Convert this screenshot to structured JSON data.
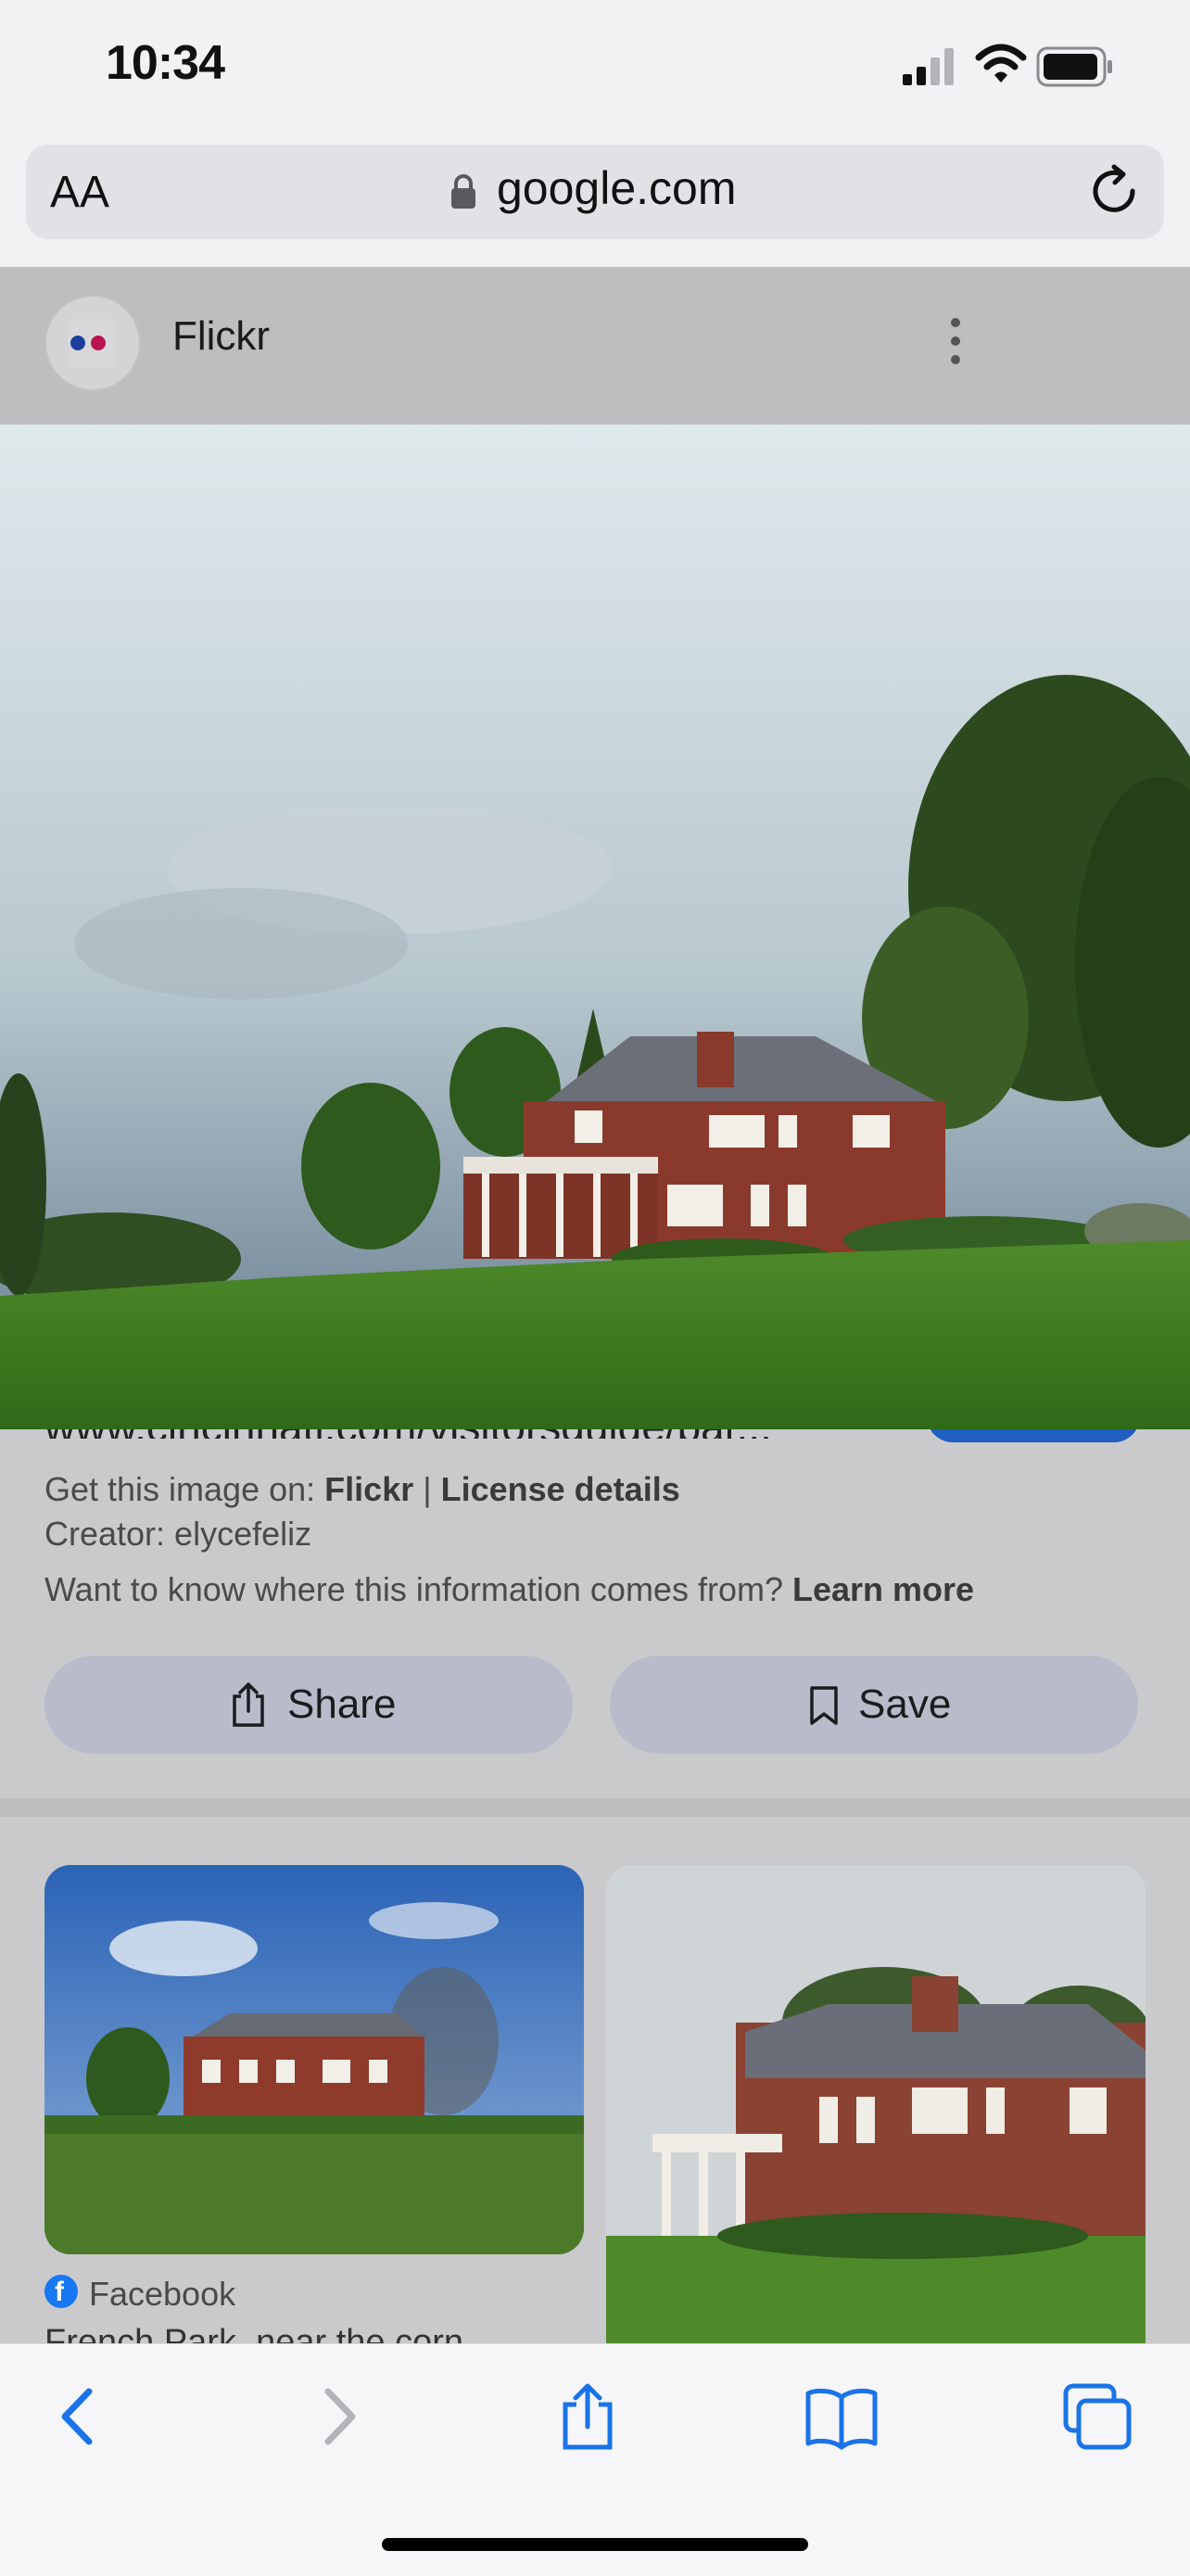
{
  "status_bar": {
    "time": "10:34",
    "icons": [
      "cellular-signal-icon",
      "wifi-icon",
      "battery-icon"
    ]
  },
  "browser": {
    "text_size_label": "AA",
    "url": "google.com",
    "icons": [
      "lock-icon",
      "reload-icon"
    ]
  },
  "result_header": {
    "source_name": "Flickr",
    "icons": [
      "flickr-logo-icon",
      "more-options-icon"
    ]
  },
  "info": {
    "url_truncated": "www.cincinnati.com/visitorsguide/par...",
    "get_image_prefix": "Get this image on:",
    "get_image_source": "Flickr",
    "separator": "|",
    "license_link": "License details",
    "creator": "Creator: elycefeliz",
    "info_question": "Want to know where this information comes from?",
    "learn_more": "Learn more",
    "share_label": "Share",
    "save_label": "Save"
  },
  "related": {
    "items": [
      {
        "source": "Facebook",
        "caption": "French Park, near the corn..."
      },
      {
        "source": "",
        "caption": ""
      }
    ]
  },
  "toolbar": {
    "icons": [
      "back-arrow-icon",
      "forward-arrow-icon",
      "share-icon",
      "bookmarks-icon",
      "tabs-icon"
    ]
  },
  "colors": {
    "accent_blue": "#1a73e8",
    "facebook_blue": "#1877f2",
    "flickr_blue": "#0063dc",
    "flickr_pink": "#ff0084"
  }
}
